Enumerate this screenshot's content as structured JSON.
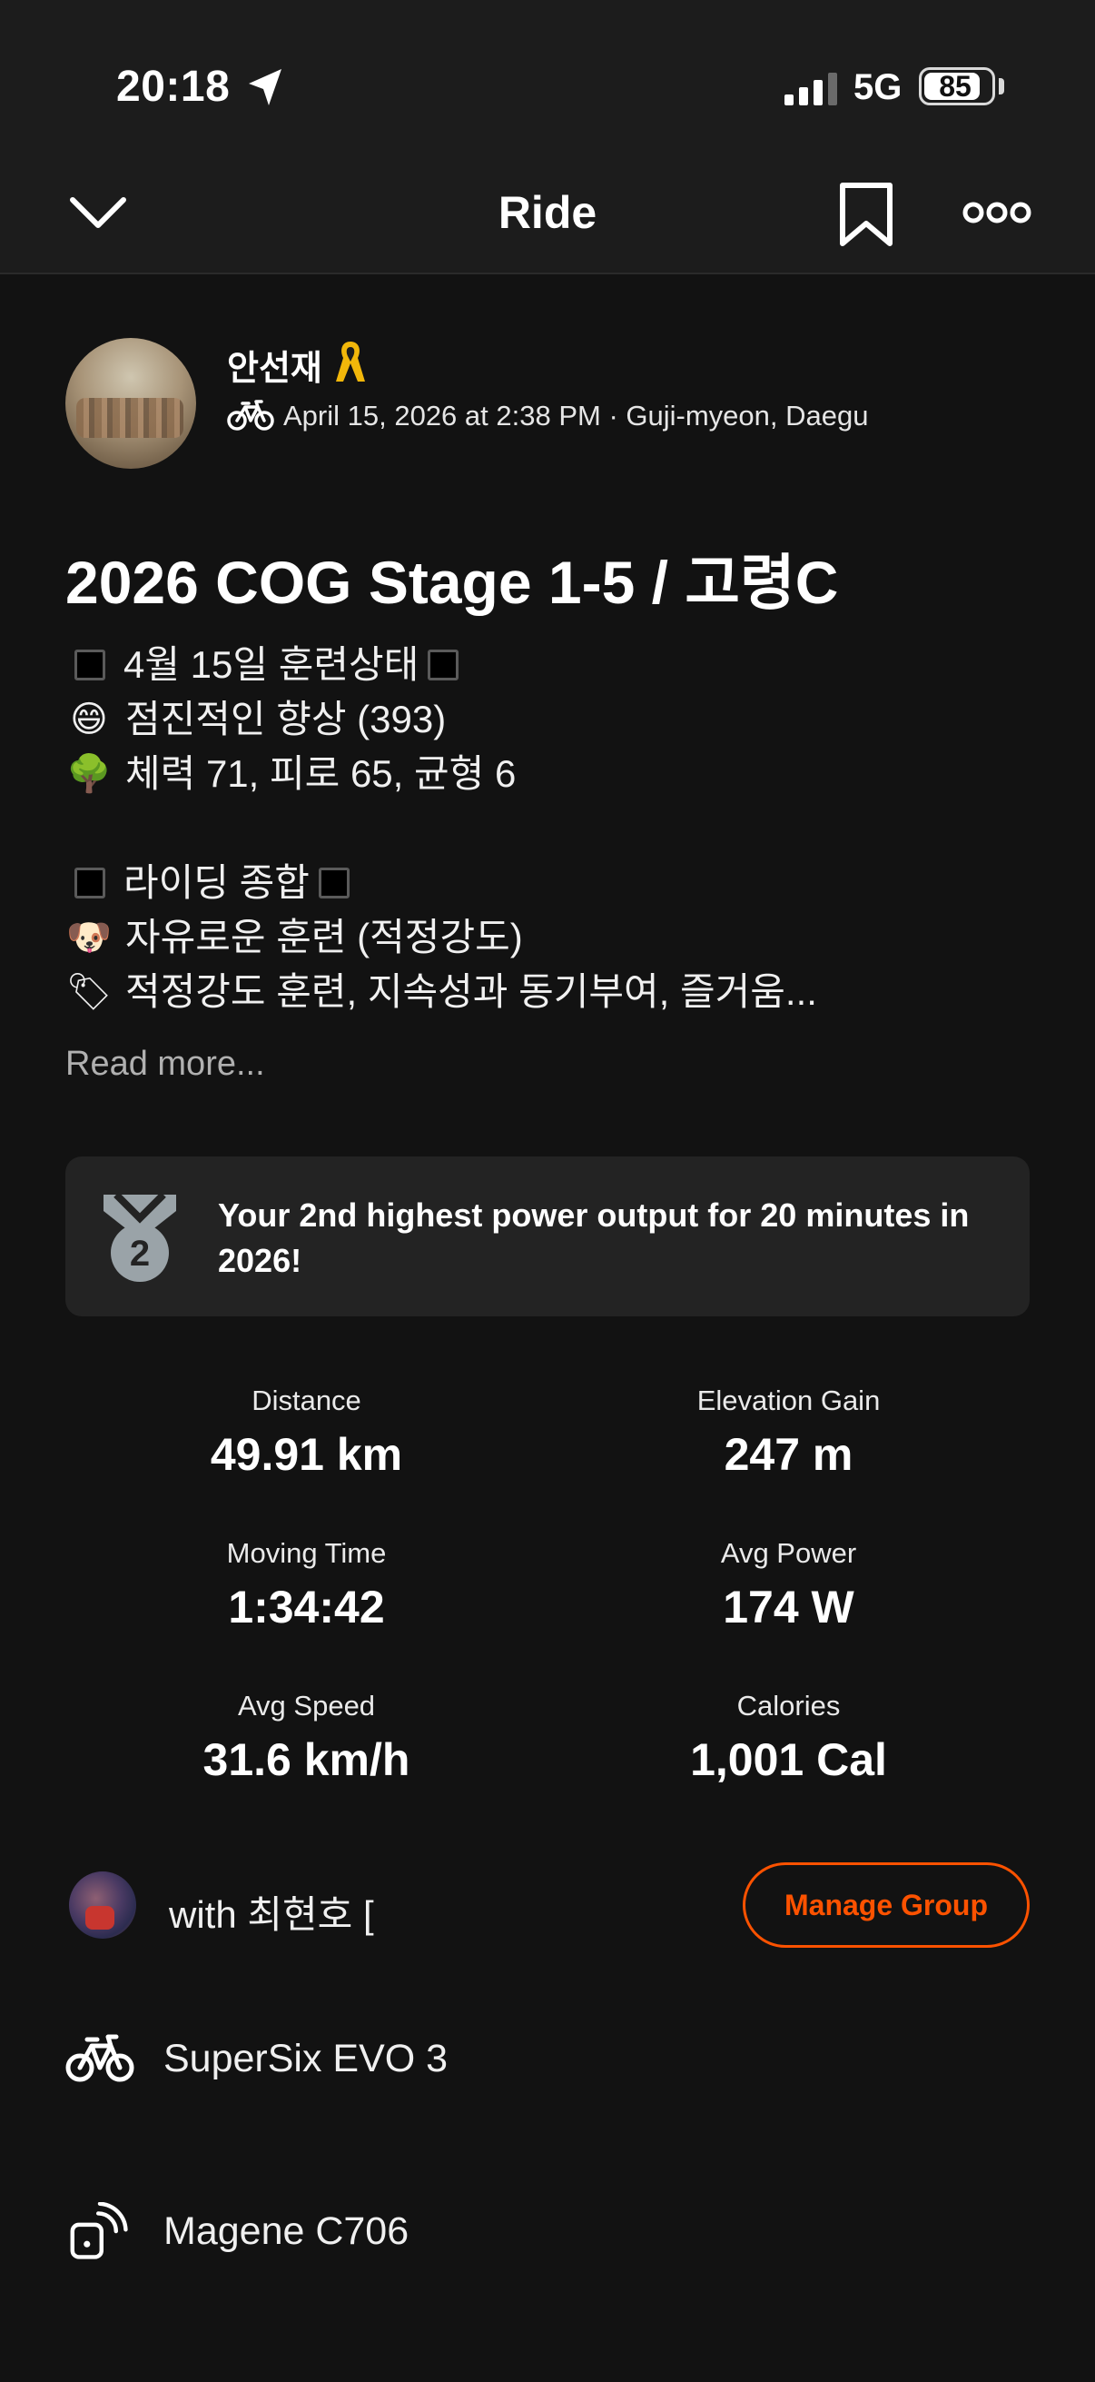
{
  "status_bar": {
    "time": "20:18",
    "network": "5G",
    "battery": "85",
    "battery_level": 0.85
  },
  "nav": {
    "title": "Ride",
    "back_icon": "chevron-down-icon",
    "bookmark_icon": "bookmark-icon",
    "more_icon": "more-options-icon"
  },
  "activity": {
    "athlete_name": "안선재",
    "meta": "April 15, 2026 at 2:38 PM · Guji-myeon, Daegu",
    "title": "2026 COG Stage 1-5 / 고령C",
    "description": [
      {
        "type": "boxed",
        "text": "4월 15일 훈련상태"
      },
      {
        "type": "emoji",
        "emoji": "😄",
        "text": "점진적인 향상 (393)"
      },
      {
        "type": "emoji",
        "emoji": "🌳",
        "text": "체력 71, 피로 65, 균형 6"
      },
      {
        "type": "blank",
        "text": ""
      },
      {
        "type": "boxed",
        "text": "라이딩 종합"
      },
      {
        "type": "emoji",
        "emoji": "🐶",
        "text": "자유로운 훈련 (적정강도)"
      },
      {
        "type": "emoji",
        "emoji": "🏷",
        "text": "적정강도 훈련, 지속성과 동기부여, 즐거움..."
      }
    ],
    "read_more": "Read more...",
    "achievement": {
      "text": "Your 2nd highest power output for 20 minutes in 2026!",
      "medal_number": "2"
    },
    "stats": [
      {
        "label": "Distance",
        "value": "49.91 km"
      },
      {
        "label": "Elevation Gain",
        "value": "247 m"
      },
      {
        "label": "Moving Time",
        "value": "1:34:42"
      },
      {
        "label": "Avg Power",
        "value": "174 W"
      },
      {
        "label": "Avg Speed",
        "value": "31.6 km/h"
      },
      {
        "label": "Calories",
        "value": "1,001 Cal"
      }
    ],
    "group": {
      "with_text": "with 최현호 [",
      "manage_label": "Manage Group"
    },
    "gear": [
      {
        "icon": "bike-icon",
        "label": "SuperSix EVO 3"
      },
      {
        "icon": "device-icon",
        "label": "Magene C706"
      }
    ]
  },
  "colors": {
    "accent": "#fc5200",
    "background": "#121212",
    "header": "#1c1c1c",
    "card": "#232323"
  }
}
